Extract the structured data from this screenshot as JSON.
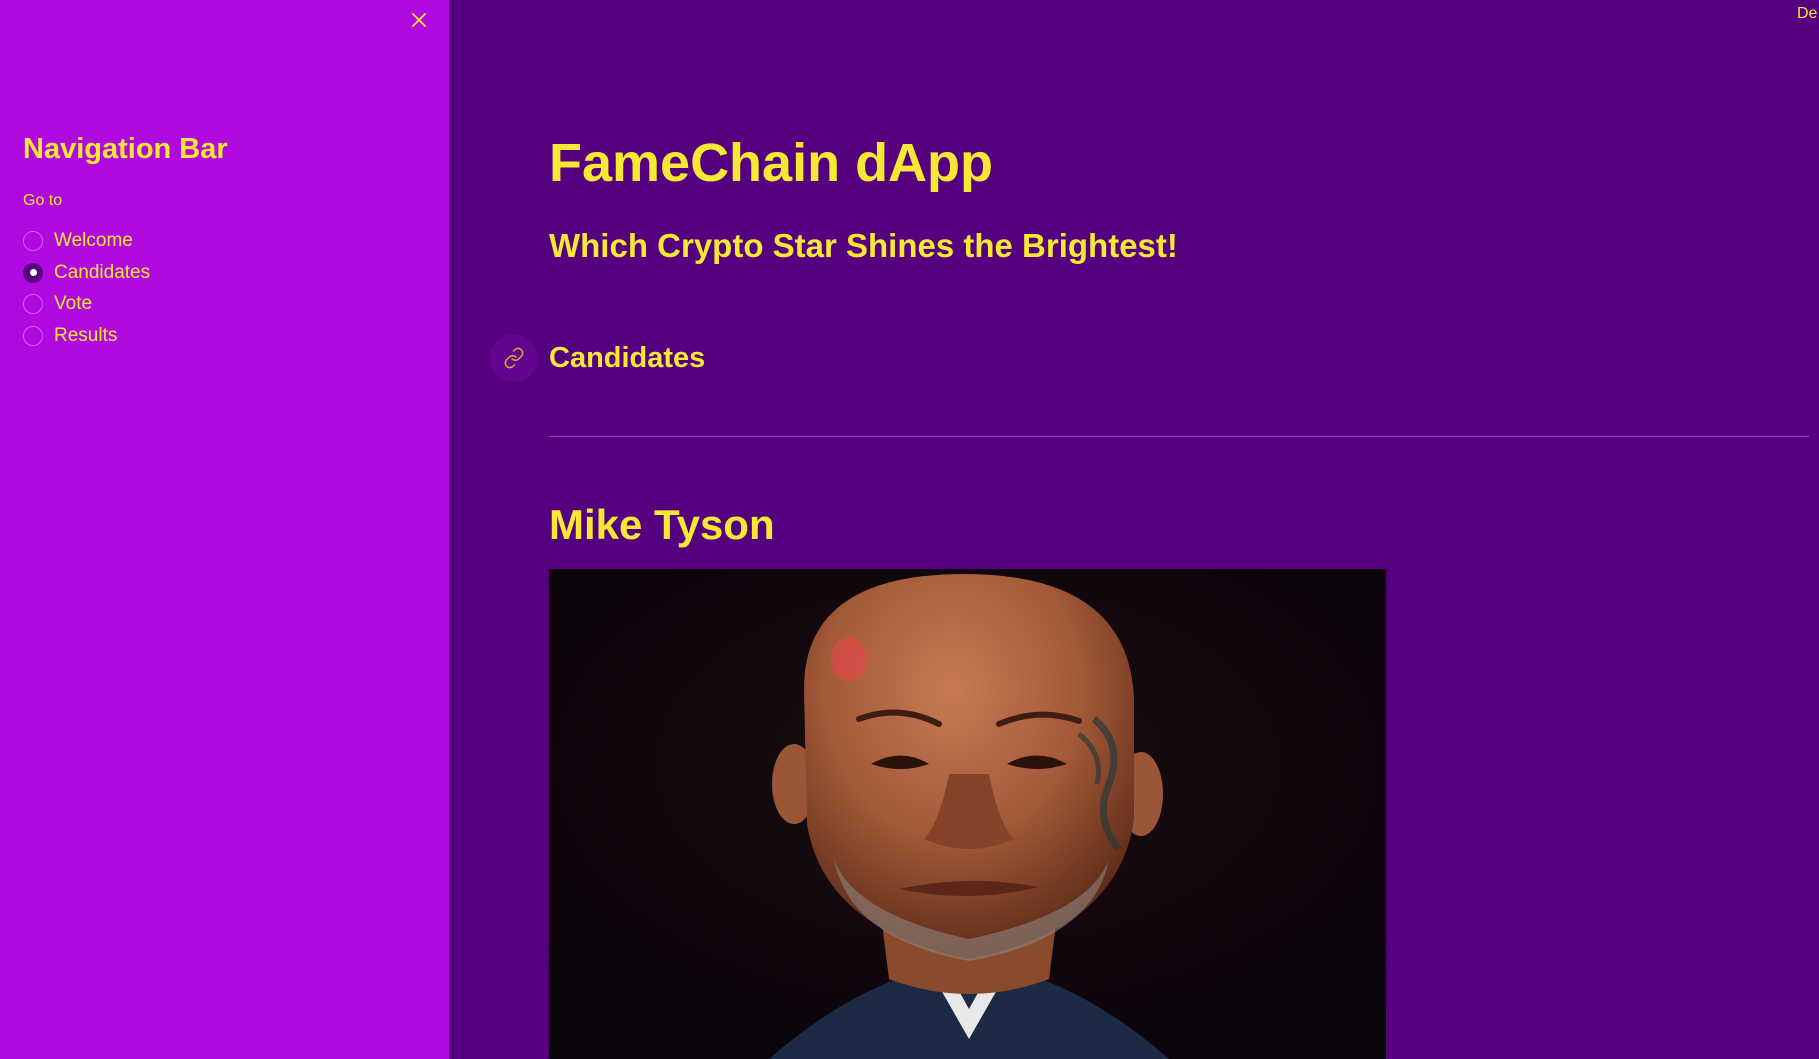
{
  "sidebar": {
    "close_icon": "close-icon",
    "title": "Navigation Bar",
    "radio_label": "Go to",
    "options": [
      {
        "label": "Welcome",
        "selected": false
      },
      {
        "label": "Candidates",
        "selected": true
      },
      {
        "label": "Vote",
        "selected": false
      },
      {
        "label": "Results",
        "selected": false
      }
    ]
  },
  "header": {
    "top_right_text": "De"
  },
  "main": {
    "title": "FameChain dApp",
    "subtitle": "Which Crypto Star Shines the Brightest!",
    "section_heading": "Candidates",
    "anchor_icon": "link-icon",
    "candidate": {
      "name": "Mike Tyson"
    }
  },
  "colors": {
    "sidebar_bg": "#b10ae0",
    "main_bg": "#55017f",
    "text": "#f6e833",
    "divider": "#9a4ab8"
  }
}
